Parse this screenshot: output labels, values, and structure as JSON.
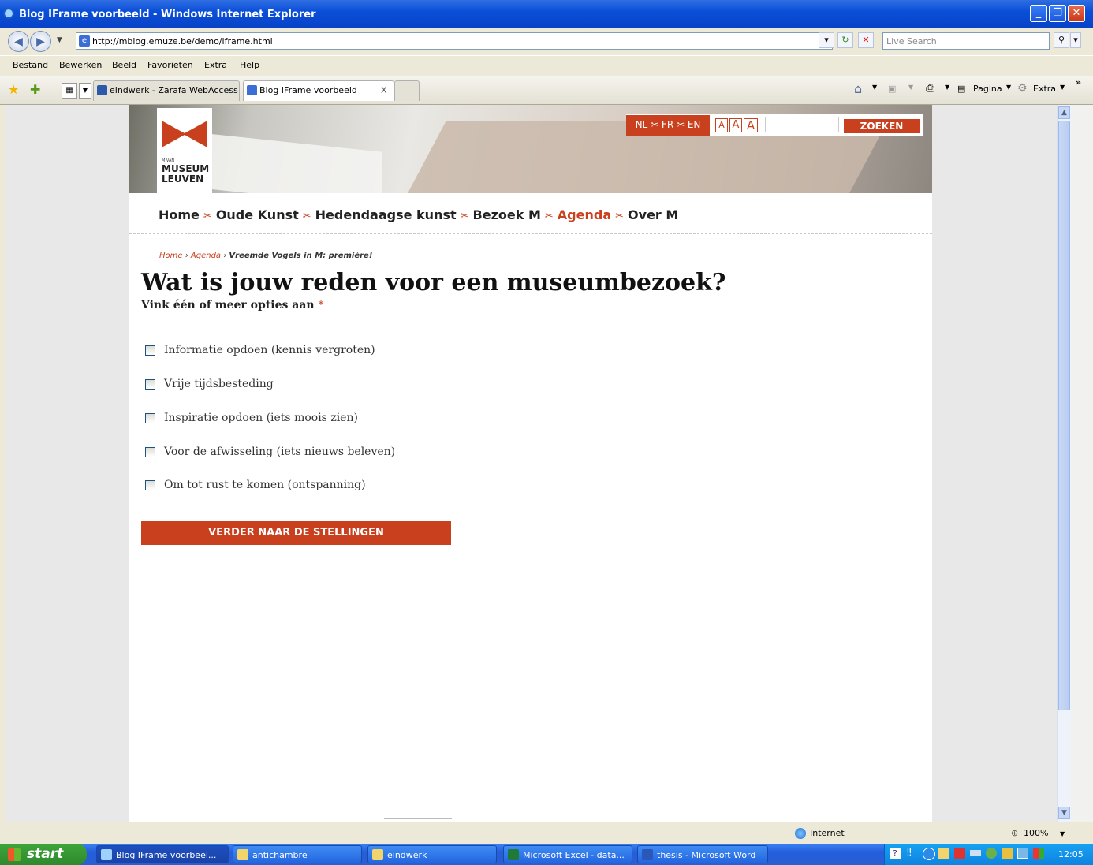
{
  "window": {
    "title": "Blog IFrame voorbeeld - Windows Internet Explorer"
  },
  "address": {
    "url": "http://mblog.emuze.be/demo/iframe.html",
    "search_placeholder": "Live Search"
  },
  "menu": [
    "Bestand",
    "Bewerken",
    "Beeld",
    "Favorieten",
    "Extra",
    "Help"
  ],
  "tabs": [
    {
      "label": "eindwerk - Zarafa WebAccess"
    },
    {
      "label": "Blog IFrame voorbeeld",
      "close": "X"
    }
  ],
  "toolbar": {
    "pagina": "Pagina",
    "extra": "Extra"
  },
  "site": {
    "logo": {
      "small": "M VAN",
      "line1": "MUSEUM",
      "line2": "LEUVEN"
    },
    "lang": "NL ✂ FR ✂ EN",
    "font_sizes": [
      "A",
      "A",
      "A"
    ],
    "search_button": "ZOEKEN",
    "nav": [
      "Home",
      "Oude Kunst",
      "Hedendaagse kunst",
      "Bezoek M",
      "Agenda",
      "Over M"
    ],
    "nav_active": "Agenda",
    "breadcrumb": {
      "home": "Home",
      "agenda": "Agenda",
      "current": "Vreemde Vogels in M: première!"
    },
    "question": {
      "title": "Wat is jouw reden voor een museumbezoek?",
      "subtitle": "Vink één of meer opties aan",
      "required_mark": "*",
      "options": [
        "Informatie opdoen (kennis vergroten)",
        "Vrije tijdsbesteding",
        "Inspiratie opdoen (iets moois zien)",
        "Voor de afwisseling (iets nieuws beleven)",
        "Om tot rust te komen (ontspanning)"
      ],
      "submit": "VERDER NAAR DE STELLINGEN"
    }
  },
  "status": {
    "zone": "Internet",
    "zoom": "100%"
  },
  "taskbar": {
    "start": "start",
    "items": [
      {
        "label": "Blog IFrame voorbeel...",
        "icon": "ie-icon"
      },
      {
        "label": "antichambre",
        "icon": "folder-icon"
      },
      {
        "label": "eindwerk",
        "icon": "folder-icon"
      },
      {
        "label": "Microsoft Excel - data...",
        "icon": "excel-icon"
      },
      {
        "label": "thesis - Microsoft Word",
        "icon": "word-icon"
      }
    ],
    "clock": "12:05"
  },
  "colors": {
    "accent": "#c9401f",
    "xp_blue": "#0a4fd8"
  }
}
